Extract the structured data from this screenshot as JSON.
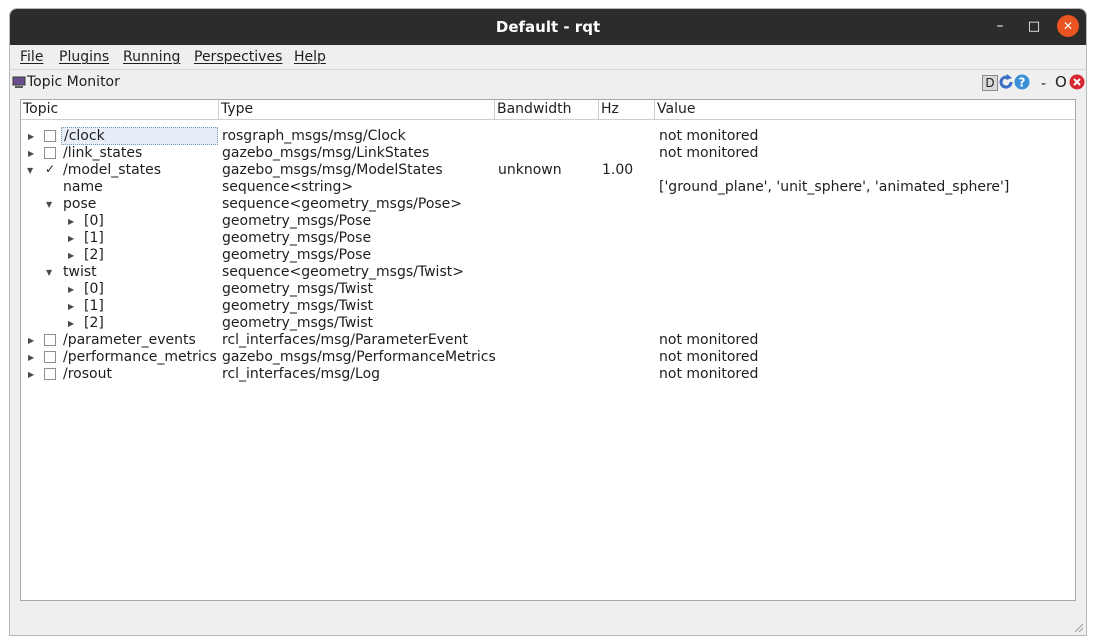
{
  "window": {
    "title": "Default - rqt",
    "controls": {
      "minimize": "–",
      "maximize": "□",
      "close": "✕"
    }
  },
  "menu": [
    "File",
    "Plugins",
    "Running",
    "Perspectives",
    "Help"
  ],
  "panel": {
    "title": "Topic Monitor",
    "tools": {
      "d": "D",
      "o": "O"
    }
  },
  "table": {
    "columns": [
      "Topic",
      "Type",
      "Bandwidth",
      "Hz",
      "Value"
    ],
    "rows": [
      {
        "topic": "/clock",
        "type": "rosgraph_msgs/msg/Clock",
        "bandwidth": "",
        "hz": "",
        "value": "not monitored"
      },
      {
        "topic": "/link_states",
        "type": "gazebo_msgs/msg/LinkStates",
        "bandwidth": "",
        "hz": "",
        "value": "not monitored"
      },
      {
        "topic": "/model_states",
        "type": "gazebo_msgs/msg/ModelStates",
        "bandwidth": "unknown",
        "hz": "1.00",
        "value": ""
      },
      {
        "topic": "name",
        "type": "sequence<string>",
        "bandwidth": "",
        "hz": "",
        "value": "['ground_plane', 'unit_sphere', 'animated_sphere']"
      },
      {
        "topic": "pose",
        "type": "sequence<geometry_msgs/Pose>",
        "bandwidth": "",
        "hz": "",
        "value": ""
      },
      {
        "topic": "[0]",
        "type": "geometry_msgs/Pose",
        "bandwidth": "",
        "hz": "",
        "value": ""
      },
      {
        "topic": "[1]",
        "type": "geometry_msgs/Pose",
        "bandwidth": "",
        "hz": "",
        "value": ""
      },
      {
        "topic": "[2]",
        "type": "geometry_msgs/Pose",
        "bandwidth": "",
        "hz": "",
        "value": ""
      },
      {
        "topic": "twist",
        "type": "sequence<geometry_msgs/Twist>",
        "bandwidth": "",
        "hz": "",
        "value": ""
      },
      {
        "topic": "[0]",
        "type": "geometry_msgs/Twist",
        "bandwidth": "",
        "hz": "",
        "value": ""
      },
      {
        "topic": "[1]",
        "type": "geometry_msgs/Twist",
        "bandwidth": "",
        "hz": "",
        "value": ""
      },
      {
        "topic": "[2]",
        "type": "geometry_msgs/Twist",
        "bandwidth": "",
        "hz": "",
        "value": ""
      },
      {
        "topic": "/parameter_events",
        "type": "rcl_interfaces/msg/ParameterEvent",
        "bandwidth": "",
        "hz": "",
        "value": "not monitored"
      },
      {
        "topic": "/performance_metrics",
        "type": "gazebo_msgs/msg/PerformanceMetrics",
        "bandwidth": "",
        "hz": "",
        "value": "not monitored"
      },
      {
        "topic": "/rosout",
        "type": "rcl_interfaces/msg/Log",
        "bandwidth": "",
        "hz": "",
        "value": "not monitored"
      }
    ]
  }
}
